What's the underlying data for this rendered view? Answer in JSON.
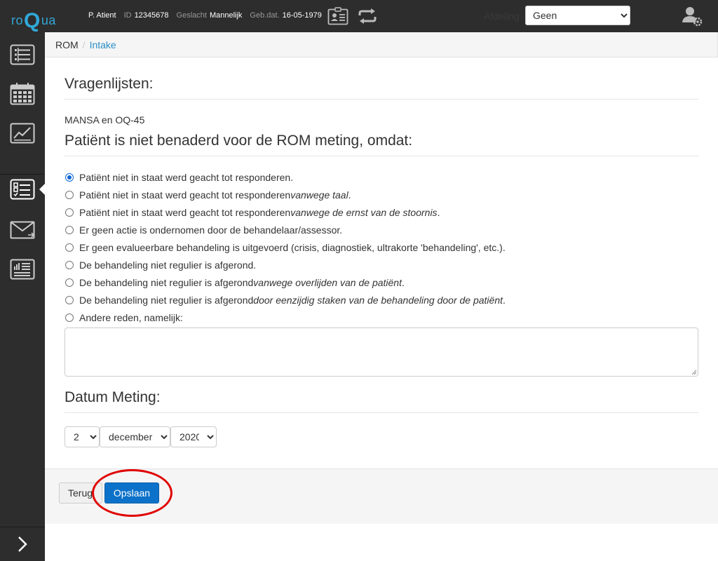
{
  "header": {
    "logo": {
      "left": "ro",
      "big": "Q",
      "right": "ua"
    },
    "patient": {
      "name": "P. Atient",
      "id_label": "ID",
      "id_value": "12345678",
      "gender_label": "Geslacht",
      "gender_value": "Mannelijk",
      "dob_label": "Geb.dat.",
      "dob_value": "16-05-1979"
    },
    "department_label": "Afdeling",
    "department_selected": "Geen"
  },
  "sidebar": {
    "items": [
      {
        "name": "list-icon"
      },
      {
        "name": "calendar-icon"
      },
      {
        "name": "chart-icon"
      },
      {
        "name": "checklist-icon",
        "active": true
      },
      {
        "name": "envelope-icon"
      },
      {
        "name": "report-icon"
      }
    ]
  },
  "breadcrumb": {
    "root": "ROM",
    "separator": "/",
    "current": "Intake"
  },
  "main": {
    "questionnaires_title": "Vragenlijsten:",
    "questionnaires_text": "MANSA en OQ-45",
    "reason_title": "Patiënt is niet benaderd voor de ROM meting, omdat:",
    "reasons": [
      {
        "text": "Patiënt niet in staat werd geacht tot responderen.",
        "em": "",
        "tail": "",
        "checked": true
      },
      {
        "text": "Patiënt niet in staat werd geacht tot responderen ",
        "em": "vanwege taal",
        "tail": ".",
        "checked": false
      },
      {
        "text": "Patiënt niet in staat werd geacht tot responderen ",
        "em": "vanwege de ernst van de stoornis",
        "tail": ".",
        "checked": false
      },
      {
        "text": "Er geen actie is ondernomen door de behandelaar/assessor.",
        "em": "",
        "tail": "",
        "checked": false
      },
      {
        "text": "Er geen evalueerbare behandeling is uitgevoerd (crisis, diagnostiek, ultrakorte 'behandeling', etc.).",
        "em": "",
        "tail": "",
        "checked": false
      },
      {
        "text": "De behandeling niet regulier is afgerond.",
        "em": "",
        "tail": "",
        "checked": false
      },
      {
        "text": "De behandeling niet regulier is afgerond ",
        "em": "vanwege overlijden van de patiënt",
        "tail": ".",
        "checked": false
      },
      {
        "text": "De behandeling niet regulier is afgerond ",
        "em": "door eenzijdig staken van de behandeling door de patiënt",
        "tail": ".",
        "checked": false
      },
      {
        "text": "Andere reden, namelijk:",
        "em": "",
        "tail": "",
        "checked": false
      }
    ],
    "other_reason_value": "",
    "date_title": "Datum Meting:",
    "date": {
      "day": "2",
      "month": "december",
      "year": "2020"
    }
  },
  "actions": {
    "back_label": "Terug",
    "save_label": "Opslaan"
  },
  "colors": {
    "accent": "#0c71c9",
    "link": "#2a8fc7",
    "logo": "#31a8d8",
    "highlight_circle": "#e00000",
    "dark_bg": "#2d2d2d"
  }
}
